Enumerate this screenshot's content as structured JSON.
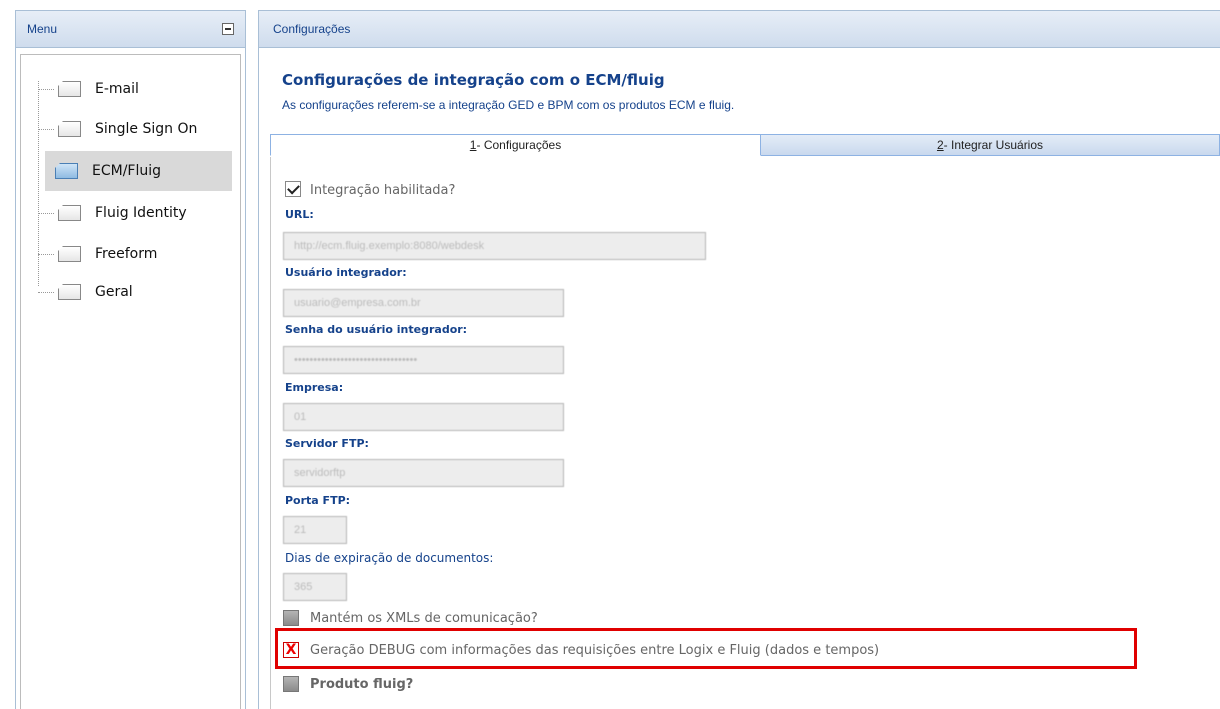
{
  "menu": {
    "title": "Menu",
    "items": [
      {
        "label": "E-mail"
      },
      {
        "label": "Single Sign On"
      },
      {
        "label": "ECM/Fluig"
      },
      {
        "label": "Fluig Identity"
      },
      {
        "label": "Freeform"
      },
      {
        "label": "Geral"
      }
    ],
    "active_item": "ECM/Fluig"
  },
  "content": {
    "header": "Configurações",
    "title": "Configurações de integração com o ECM/fluig",
    "subtitle": "As configurações referem-se a integração GED e BPM com os produtos ECM e fluig.",
    "tabs": [
      {
        "key": "1",
        "text": " - Configurações",
        "active": true
      },
      {
        "key": "2",
        "text": " - Integrar Usuários",
        "active": false
      }
    ],
    "form": {
      "integracao_label": "Integração habilitada?",
      "integracao_checked": true,
      "url_label": "URL:",
      "url_value": "http://ecm.fluig.exemplo:8080/webdesk",
      "usuario_label": "Usuário integrador:",
      "usuario_value": "usuario@empresa.com.br",
      "senha_label": "Senha do usuário integrador:",
      "senha_value": "••••••••••••••••••••••••••••••••",
      "empresa_label": "Empresa:",
      "empresa_value": "01",
      "ftp_label": "Servidor FTP:",
      "ftp_value": "servidorftp",
      "porta_label": "Porta FTP:",
      "porta_value": "21",
      "dias_label": "Dias de expiração de documentos:",
      "dias_value": "365",
      "xml_label": "Mantém os XMLs de comunicação?",
      "debug_label": "Geração DEBUG com informações das requisições entre Logix e Fluig (dados e tempos)",
      "debug_mark": "X",
      "produto_label": "Produto fluig?"
    }
  },
  "colors": {
    "header_text": "#15428b",
    "highlight_border": "#e00000",
    "active_menu_bg": "#d9d9d9"
  }
}
